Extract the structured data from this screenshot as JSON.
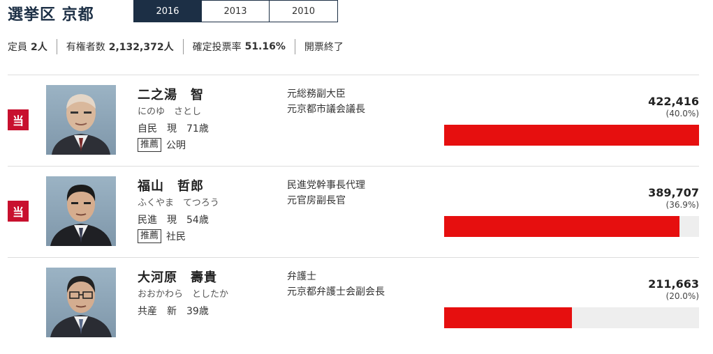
{
  "header": {
    "title": "選挙区 京都"
  },
  "tabs": [
    {
      "label": "2016",
      "active": true
    },
    {
      "label": "2013"
    },
    {
      "label": "2010"
    }
  ],
  "stats": [
    {
      "label": "定員",
      "value": "2人"
    },
    {
      "label": "有権者数",
      "value": "2,132,372人"
    },
    {
      "label": "確定投票率",
      "value": "51.16%"
    },
    {
      "label": "開票終了",
      "value": ""
    }
  ],
  "win_label": "当",
  "support_tag": "推薦",
  "colors": {
    "accent": "#1c2f45",
    "win": "#c8102e",
    "bar": "#e60f0f",
    "bar_bg": "#eeeeee"
  },
  "candidates": [
    {
      "name": "二之湯　智",
      "kana": "にのゆ　さとし",
      "party": "自民",
      "status": "現",
      "age": "71歳",
      "support": "公明",
      "career": [
        "元総務副大臣",
        "元京都市議会議長"
      ],
      "votes": "422,416",
      "pct": "(40.0%)",
      "bar_fraction": 1.0,
      "elected": true
    },
    {
      "name": "福山　哲郎",
      "kana": "ふくやま　てつろう",
      "party": "民進",
      "status": "現",
      "age": "54歳",
      "support": "社民",
      "career": [
        "民進党幹事長代理",
        "元官房副長官"
      ],
      "votes": "389,707",
      "pct": "(36.9%)",
      "bar_fraction": 0.922,
      "elected": true
    },
    {
      "name": "大河原　壽貴",
      "kana": "おおかわら　としたか",
      "party": "共産",
      "status": "新",
      "age": "39歳",
      "support": "",
      "career": [
        "弁護士",
        "元京都弁護士会副会長"
      ],
      "votes": "211,663",
      "pct": "(20.0%)",
      "bar_fraction": 0.5,
      "elected": false
    }
  ]
}
